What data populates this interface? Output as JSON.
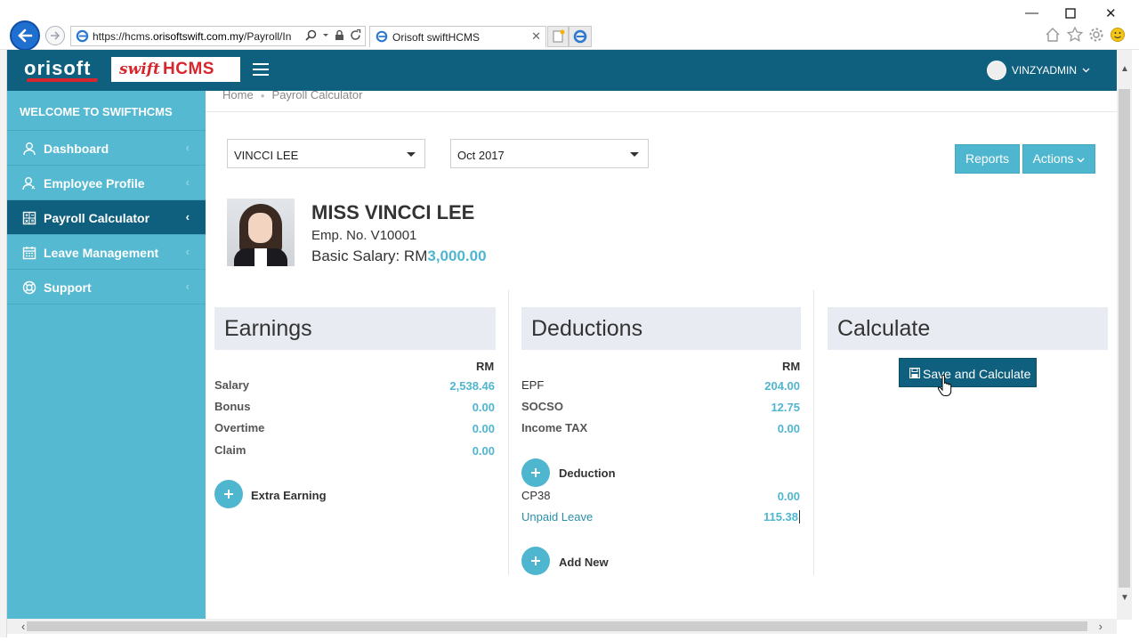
{
  "browser": {
    "url_prefix": "https://hcms.",
    "url_domain": "orisoftswift.com.my",
    "url_suffix": "/Payroll/In",
    "tab_title": "Orisoft swiftHCMS"
  },
  "header": {
    "logo_text": "orisoft",
    "brand_swift": "swift",
    "brand_hcms": "HCMS",
    "username": "VINZYADMIN"
  },
  "sidebar": {
    "welcome": "WELCOME TO SWIFTHCMS",
    "items": [
      {
        "label": "Dashboard",
        "icon": "user-icon"
      },
      {
        "label": "Employee Profile",
        "icon": "profile-icon"
      },
      {
        "label": "Payroll Calculator",
        "icon": "calculator-icon",
        "active": true
      },
      {
        "label": "Leave Management",
        "icon": "calendar-icon"
      },
      {
        "label": "Support",
        "icon": "lifebuoy-icon"
      }
    ]
  },
  "breadcrumb": {
    "home": "Home",
    "current": "Payroll Calculator"
  },
  "filters": {
    "employee": "VINCCI LEE",
    "period": "Oct 2017"
  },
  "toolbar": {
    "reports_label": "Reports",
    "actions_label": "Actions"
  },
  "employee": {
    "name": "MISS VINCCI LEE",
    "emp_no": "Emp. No. V10001",
    "basic_salary_label": "Basic Salary: RM",
    "basic_salary_value": "3,000.00"
  },
  "earnings": {
    "title": "Earnings",
    "currency": "RM",
    "rows": [
      {
        "label": "Salary",
        "value": "2,538.46"
      },
      {
        "label": "Bonus",
        "value": "0.00"
      },
      {
        "label": "Overtime",
        "value": "0.00"
      },
      {
        "label": "Claim",
        "value": "0.00"
      }
    ],
    "add_label": "Extra Earning"
  },
  "deductions": {
    "title": "Deductions",
    "currency": "RM",
    "rows": [
      {
        "label": "EPF",
        "value": "204.00"
      },
      {
        "label": "SOCSO",
        "value": "12.75"
      },
      {
        "label": "Income TAX",
        "value": "0.00"
      }
    ],
    "deduction_add_label": "Deduction",
    "extra_rows": [
      {
        "label": "CP38",
        "value": "0.00"
      },
      {
        "label": "Unpaid Leave",
        "value": "115.38"
      }
    ],
    "add_new_label": "Add New"
  },
  "calculate": {
    "title": "Calculate",
    "button_label": "Save and Calculate"
  },
  "colors": {
    "header": "#0f5f7e",
    "sidebar": "#54b9d1",
    "accent": "#4fb6cf"
  }
}
